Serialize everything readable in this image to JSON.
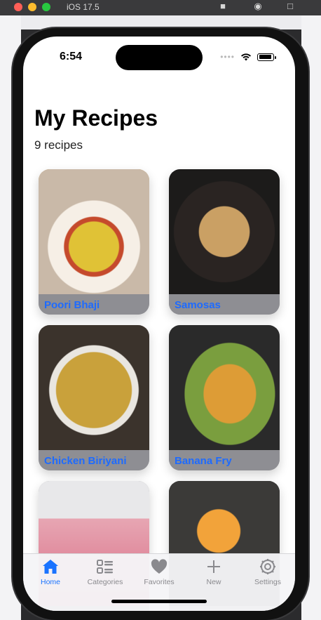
{
  "simulator": {
    "title": "iOS 17.5"
  },
  "status_bar": {
    "time": "6:54"
  },
  "page": {
    "title": "My Recipes",
    "subtitle": "9 recipes"
  },
  "recipes": [
    {
      "name": "Poori Bhaji"
    },
    {
      "name": "Samosas"
    },
    {
      "name": "Chicken Biriyani"
    },
    {
      "name": "Banana Fry"
    },
    {
      "name": ""
    },
    {
      "name": ""
    }
  ],
  "tabs": [
    {
      "label": "Home",
      "icon": "house-icon",
      "active": true
    },
    {
      "label": "Categories",
      "icon": "list-icon",
      "active": false
    },
    {
      "label": "Favorites",
      "icon": "heart-icon",
      "active": false
    },
    {
      "label": "New",
      "icon": "plus-icon",
      "active": false
    },
    {
      "label": "Settings",
      "icon": "gear-icon",
      "active": false
    }
  ],
  "colors": {
    "accent": "#1a73ff",
    "card_label": "#1e6bff"
  }
}
